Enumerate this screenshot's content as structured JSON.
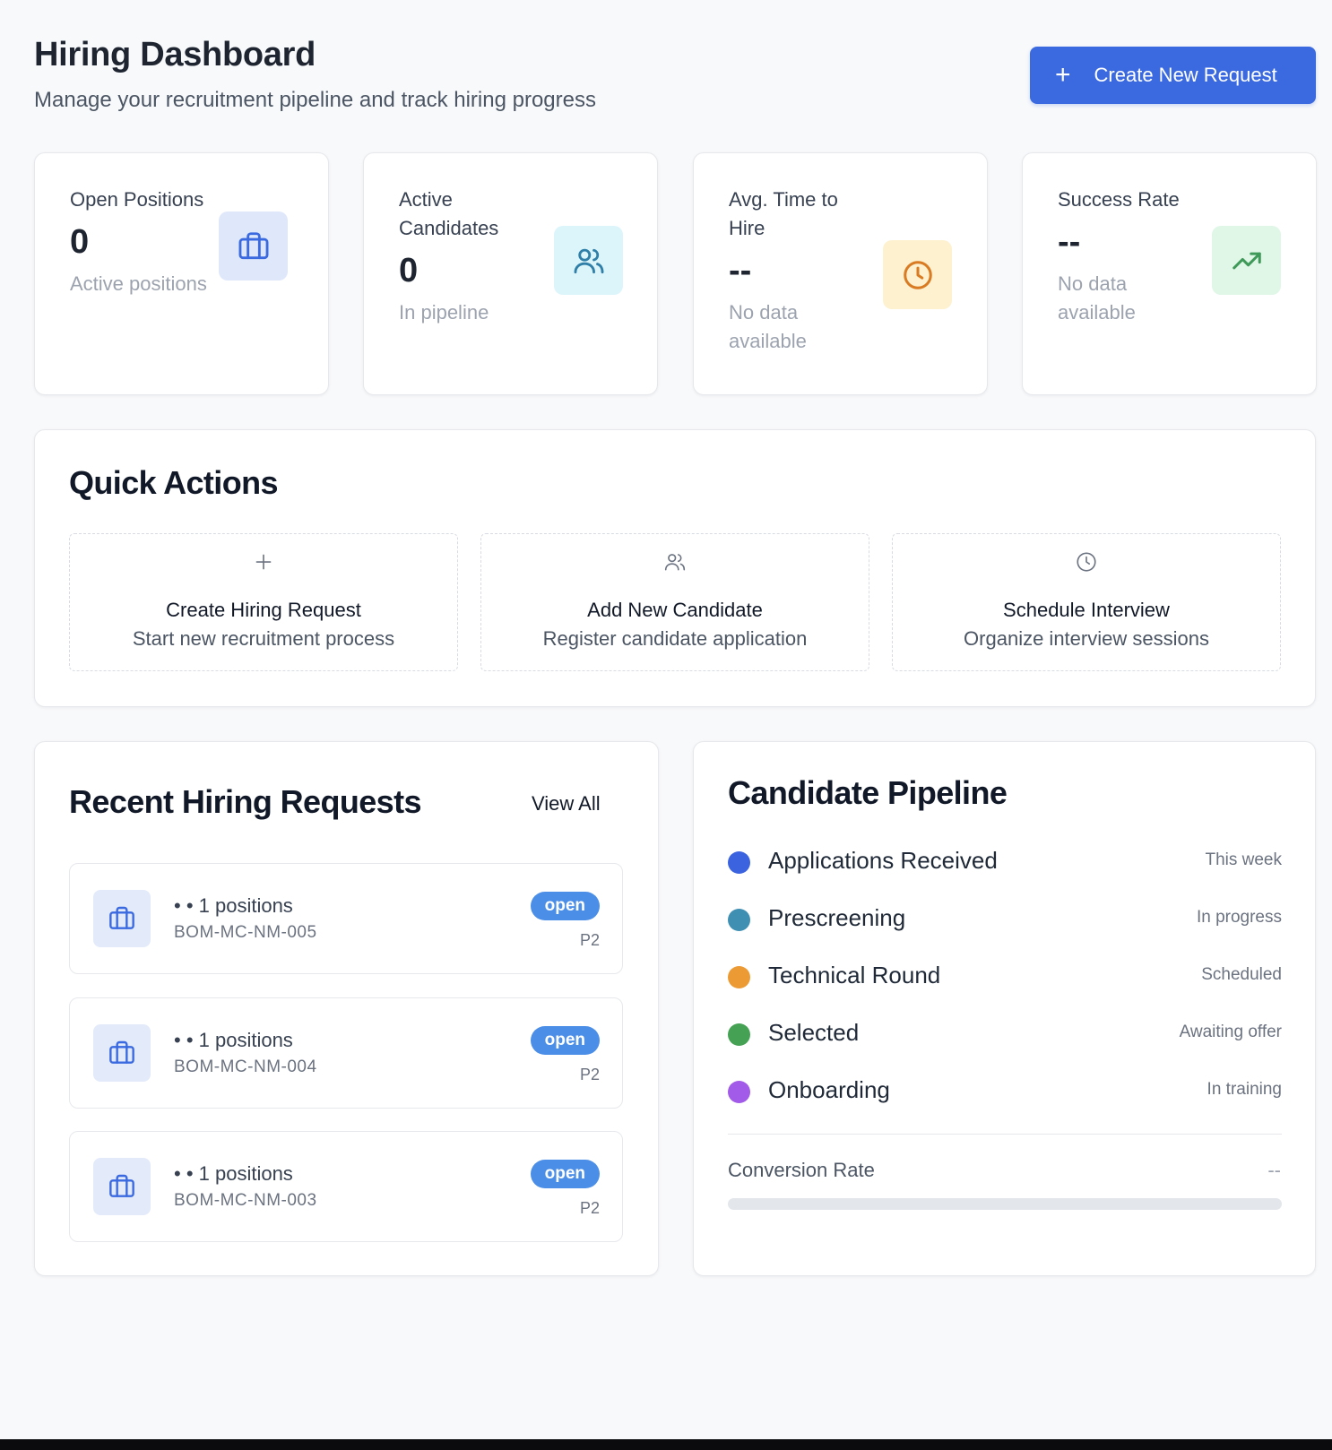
{
  "header": {
    "title": "Hiring Dashboard",
    "subtitle": "Manage your recruitment pipeline and track hiring progress",
    "create_button": {
      "icon": "plus-icon",
      "label": "Create New Request"
    }
  },
  "stats": [
    {
      "label": "Open Positions",
      "value": "0",
      "sub": "Active positions",
      "icon": "briefcase-icon",
      "icon_bg": "#dfe8fb",
      "icon_color": "#3b6ae0"
    },
    {
      "label": "Active Candidates",
      "value": "0",
      "sub": "In pipeline",
      "icon": "users-icon",
      "icon_bg": "#dcf5fb",
      "icon_color": "#2f7fa8"
    },
    {
      "label": "Avg. Time to Hire",
      "value": "--",
      "sub": "No data available",
      "icon": "clock-icon",
      "icon_bg": "#fdf1cf",
      "icon_color": "#d97b22"
    },
    {
      "label": "Success Rate",
      "value": "--",
      "sub": "No data available",
      "icon": "trending-up-icon",
      "icon_bg": "#e0f6e7",
      "icon_color": "#3f9a59"
    }
  ],
  "quick_actions": {
    "title": "Quick Actions",
    "items": [
      {
        "icon": "plus-icon",
        "title": "Create Hiring Request",
        "desc": "Start new recruitment process"
      },
      {
        "icon": "users-icon",
        "title": "Add New Candidate",
        "desc": "Register candidate application"
      },
      {
        "icon": "clock-icon",
        "title": "Schedule Interview",
        "desc": "Organize interview sessions"
      }
    ]
  },
  "recent_requests": {
    "title": "Recent Hiring Requests",
    "view_all": "View All",
    "items": [
      {
        "title": "• • 1 positions",
        "code": "BOM-MC-NM-005",
        "status": "open",
        "priority": "P2",
        "icon": "briefcase-icon"
      },
      {
        "title": "• • 1 positions",
        "code": "BOM-MC-NM-004",
        "status": "open",
        "priority": "P2",
        "icon": "briefcase-icon"
      },
      {
        "title": "• • 1 positions",
        "code": "BOM-MC-NM-003",
        "status": "open",
        "priority": "P2",
        "icon": "briefcase-icon"
      }
    ]
  },
  "pipeline": {
    "title": "Candidate Pipeline",
    "stages": [
      {
        "name": "Applications Received",
        "status": "This week",
        "color": "#3b63e0"
      },
      {
        "name": "Prescreening",
        "status": "In progress",
        "color": "#3f8fb3"
      },
      {
        "name": "Technical Round",
        "status": "Scheduled",
        "color": "#ec9a33"
      },
      {
        "name": "Selected",
        "status": "Awaiting offer",
        "color": "#45a153"
      },
      {
        "name": "Onboarding",
        "status": "In training",
        "color": "#a25ae8"
      }
    ],
    "conversion_label": "Conversion Rate",
    "conversion_value": "--",
    "conversion_fraction": 0
  }
}
